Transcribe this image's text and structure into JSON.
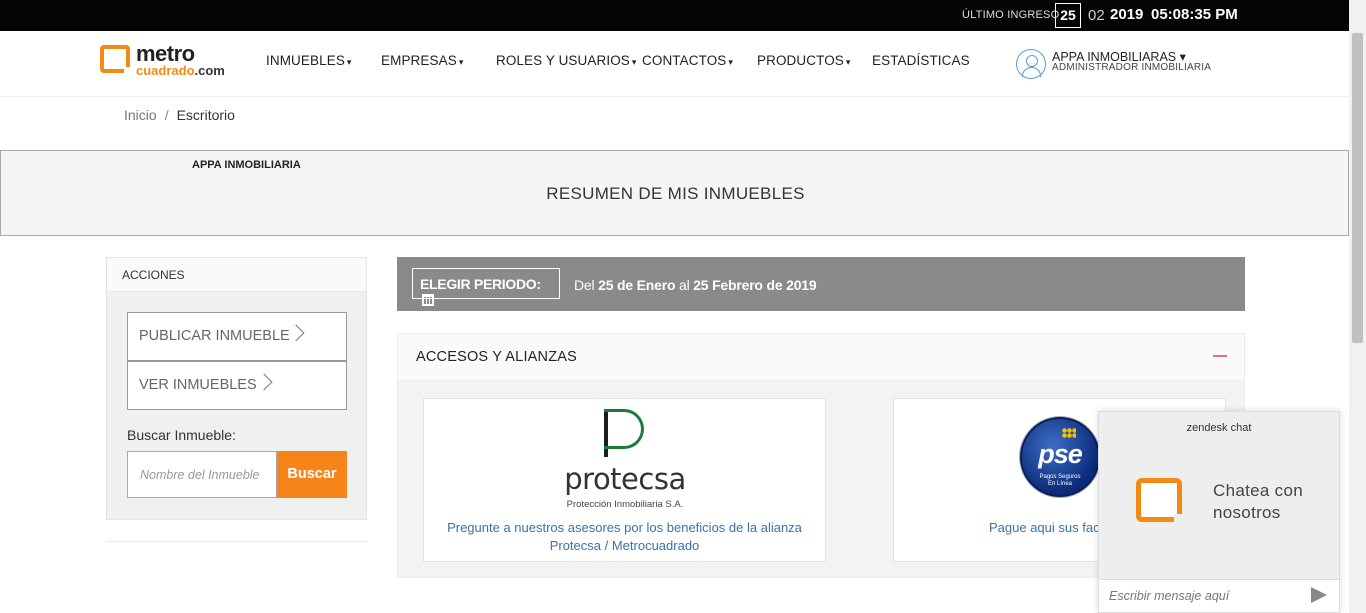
{
  "topbar": {
    "last_login_label": "ÚLTIMO INGRESO",
    "day": "25",
    "month": "02",
    "year": "2019",
    "time": "05:08:35 PM"
  },
  "header": {
    "logo_word1": "metro",
    "logo_word2a": "cuadrado",
    "logo_word2b": ".com",
    "nav": [
      {
        "label": "INMUEBLES",
        "caret": "▾"
      },
      {
        "label": "EMPRESAS",
        "caret": "▾"
      },
      {
        "label": "ROLES Y USUARIOS",
        "caret": "▾"
      },
      {
        "label": "CONTACTOS",
        "caret": "▾"
      },
      {
        "label": "PRODUCTOS",
        "caret": "▾"
      },
      {
        "label": "ESTADÍSTICAS"
      }
    ],
    "user_name": "APPA INMOBILIARAS ▾",
    "user_role": "ADMINISTRADOR INMOBILIARIA"
  },
  "breadcrumb": {
    "home": "Inicio",
    "separator": "/",
    "current": "Escritorio"
  },
  "banner": {
    "company": "APPA INMOBILIARIA",
    "title": "RESUMEN DE MIS INMUEBLES"
  },
  "actions": {
    "header": "ACCIONES",
    "publish": "PUBLICAR INMUEBLE",
    "view": "VER INMUEBLES",
    "search_label": "Buscar Inmueble:",
    "search_placeholder": "Nombre del Inmueble",
    "search_button": "Buscar"
  },
  "period": {
    "button": "ELEGIR PERIODO:",
    "prefix": "Del",
    "from": "25 de Enero",
    "middle": "al",
    "to": "25 Febrero de 2019"
  },
  "accesos": {
    "title": "ACCESOS Y ALIANZAS",
    "protecsa": {
      "logo_word": "protecsa",
      "logo_sub": "Protección Inmobiliaria S.A.",
      "desc_line1": "Pregunte a nuestros asesores por los beneficios de la alianza",
      "desc_line2": "Protecsa / Metrocuadrado"
    },
    "pse": {
      "logo_word": "pse",
      "logo_sub1": "Pagos Seguros",
      "logo_sub2": "En Línea",
      "desc": "Pague aqui sus fac"
    }
  },
  "chat": {
    "title": "zendesk chat",
    "message_line1": "Chatea con",
    "message_line2": "nosotros",
    "input_placeholder": "Escribir mensaje aquí"
  },
  "colors": {
    "brand_orange": "#f68418",
    "topbar": "#050505",
    "period_bar": "#8a8a8a",
    "link_blue": "#3a73a8"
  }
}
